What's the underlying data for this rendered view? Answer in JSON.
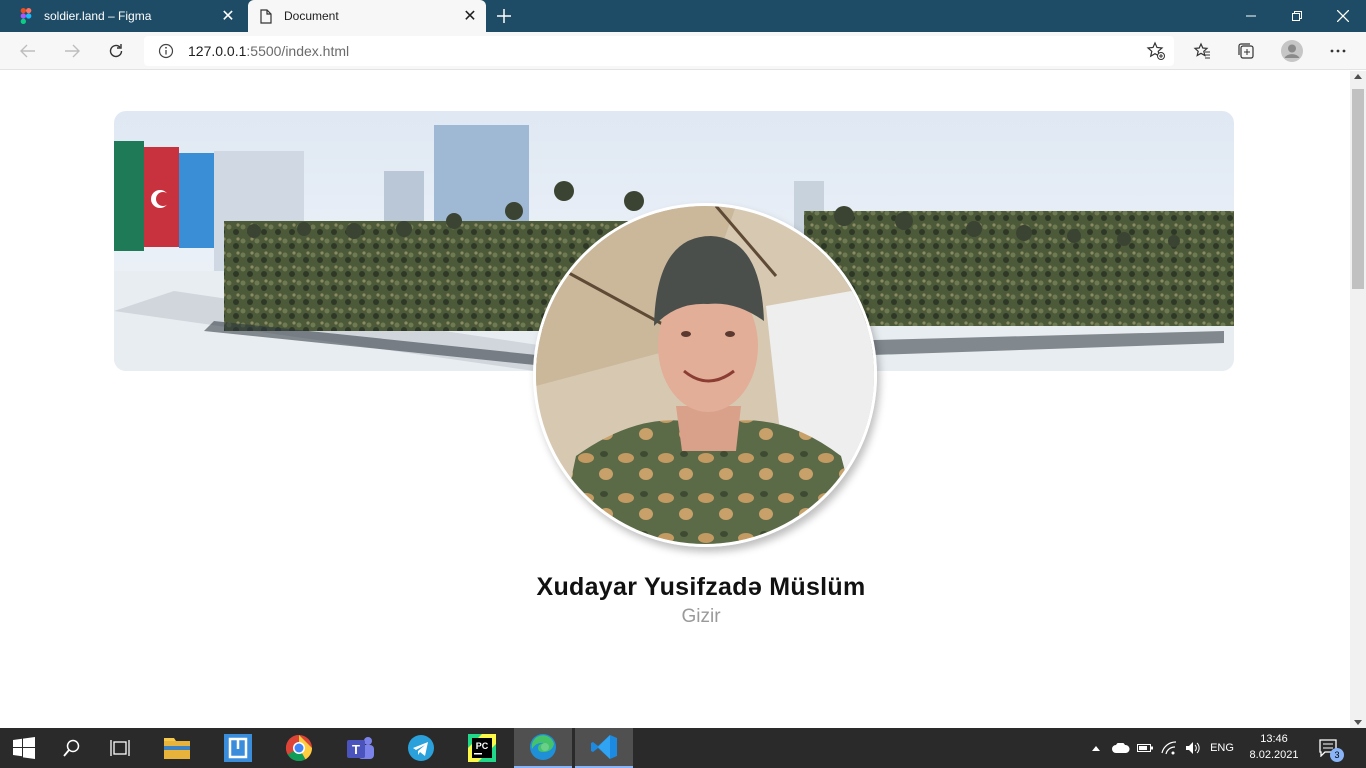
{
  "browser": {
    "tabs": [
      {
        "title": "soldier.land – Figma",
        "active": false
      },
      {
        "title": "Document",
        "active": true
      }
    ],
    "url": {
      "host": "127.0.0.1",
      "rest": ":5500/index.html"
    }
  },
  "profile": {
    "name": "Xudayar Yusifzadə Müslüm",
    "rank": "Gizir"
  },
  "taskbar": {
    "language": "ENG",
    "time": "13:46",
    "date": "8.02.2021",
    "notification_count": "3"
  },
  "colors": {
    "titlebar": "#1e4c66",
    "taskbar": "#2a2a2a",
    "accent": "#8ab4f8"
  }
}
